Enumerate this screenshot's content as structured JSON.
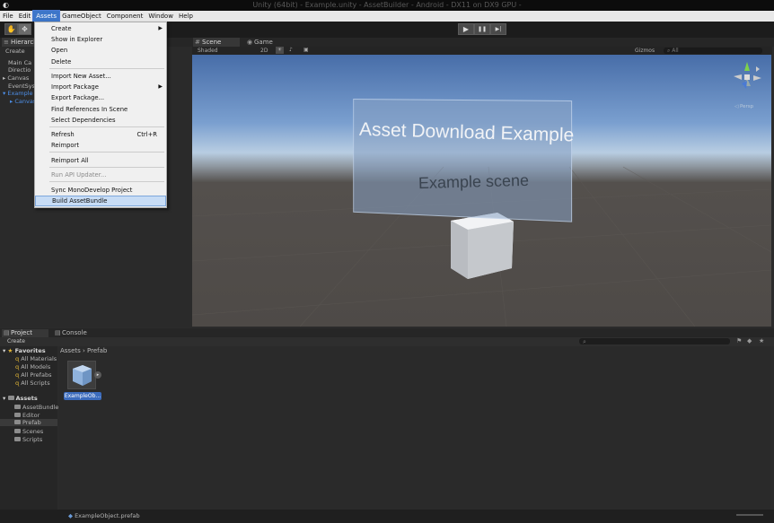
{
  "window": {
    "title": "Unity (64bit) - Example.unity - AssetBuilder - Android - DX11 on DX9 GPU -"
  },
  "menubar": {
    "items": [
      "File",
      "Edit",
      "Assets",
      "GameObject",
      "Component",
      "Window",
      "Help"
    ]
  },
  "toolbar": {
    "play": "▶",
    "pause": "❚❚",
    "step": "▶|"
  },
  "assets_menu": {
    "items": [
      {
        "label": "Create",
        "submenu": true
      },
      {
        "label": "Show in Explorer"
      },
      {
        "label": "Open"
      },
      {
        "label": "Delete"
      },
      {
        "label": "Import New Asset..."
      },
      {
        "label": "Import Package",
        "submenu": true
      },
      {
        "label": "Export Package..."
      },
      {
        "label": "Find References In Scene"
      },
      {
        "label": "Select Dependencies"
      },
      {
        "label": "Refresh",
        "shortcut": "Ctrl+R"
      },
      {
        "label": "Reimport"
      },
      {
        "label": "Reimport All"
      },
      {
        "label": "Run API Updater...",
        "disabled": true
      },
      {
        "label": "Sync MonoDevelop Project"
      },
      {
        "label": "Build AssetBundle",
        "highlighted": true
      }
    ]
  },
  "hierarchy": {
    "tab": "Hierarchy",
    "create": "Create",
    "rows": [
      "Main Ca",
      "Directio",
      "Canvas",
      "EventSys",
      "Example",
      "Canvas"
    ]
  },
  "scene": {
    "tab_scene": "Scene",
    "tab_game": "Game",
    "shading": "Shaded",
    "mode_2d": "2D",
    "gizmos": "Gizmos",
    "search_all": "All",
    "persp": "Persp",
    "title_text": "Asset Download Example",
    "subtitle_text": "Example scene"
  },
  "project": {
    "tab_project": "Project",
    "tab_console": "Console",
    "create": "Create",
    "breadcrumb": "Assets › Prefab",
    "favorites": {
      "label": "Favorites",
      "items": [
        "All Materials",
        "All Models",
        "All Prefabs",
        "All Scripts"
      ]
    },
    "assets": {
      "label": "Assets",
      "folders": [
        "AssetBundle",
        "Editor",
        "Prefab",
        "Scenes",
        "Scripts"
      ]
    },
    "asset_item": "ExampleOb...",
    "status_file": "ExampleObject.prefab"
  },
  "colors": {
    "accent": "#3d76c9",
    "menu_bg": "#f0f0f0",
    "highlight": "#c7dcf5",
    "favorites_star": "#e5b837"
  }
}
